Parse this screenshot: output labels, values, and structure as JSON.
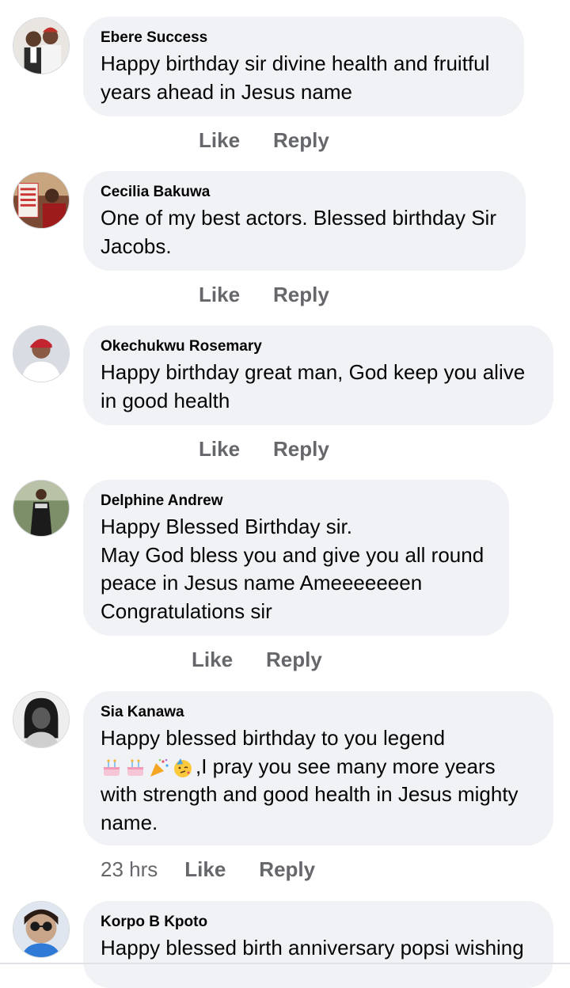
{
  "comments": [
    {
      "author": "Ebere Success",
      "text": "Happy birthday sir divine health and fruitful\nyears ahead in Jesus name",
      "like": "Like",
      "reply": "Reply",
      "avatar": "couple-photo-avatar"
    },
    {
      "author": "Cecilia Bakuwa",
      "text": "One of my best actors. Blessed birthday Sir\nJacobs.",
      "like": "Like",
      "reply": "Reply",
      "avatar": "sign-photo-avatar"
    },
    {
      "author": "Okechukwu Rosemary",
      "text": "Happy birthday great man, God keep you  alive\nin good health",
      "like": "Like",
      "reply": "Reply",
      "avatar": "woman-red-headwrap-avatar"
    },
    {
      "author": "Delphine Andrew",
      "text": "Happy Blessed Birthday sir.\nMay God bless you and give you all round\npeace in Jesus name Ameeeeeeen\nCongratulations sir",
      "like": "Like",
      "reply": "Reply",
      "avatar": "woman-standing-avatar"
    },
    {
      "author": "Sia Kanawa",
      "text_line1": "Happy blessed birthday to you legend",
      "text_line2_after_emoji": ",I pray you see many more years",
      "text_rest": "with strength and good health in Jesus mighty\nname.",
      "emojis": [
        "birthday-cake-emoji",
        "birthday-cake-emoji",
        "party-popper-emoji",
        "partying-face-emoji"
      ],
      "time": "23 hrs",
      "like": "Like",
      "reply": "Reply",
      "avatar": "woman-bw-portrait-avatar"
    },
    {
      "author": "Korpo B Kpoto",
      "text": "Happy blessed birth anniversary popsi wishing",
      "avatar": "woman-sunglasses-avatar"
    }
  ],
  "colors": {
    "bubble": "#f0f2f5",
    "secondary_text": "#65676b",
    "primary_text": "#050505"
  }
}
